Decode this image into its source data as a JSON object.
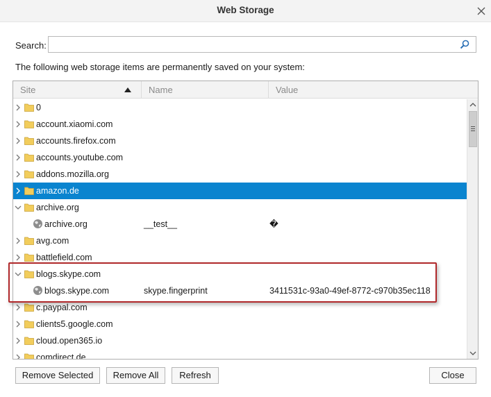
{
  "window": {
    "title": "Web Storage"
  },
  "search": {
    "label": "Search:",
    "value": "",
    "placeholder": ""
  },
  "description": "The following web storage items are permanently saved on your system:",
  "table": {
    "columns": {
      "site": "Site",
      "name": "Name",
      "value": "Value"
    },
    "sort": {
      "column": "Site",
      "direction": "ascending"
    },
    "rows": [
      {
        "type": "folder",
        "site": "0",
        "expanded": false,
        "selected": false
      },
      {
        "type": "folder",
        "site": "account.xiaomi.com",
        "expanded": false,
        "selected": false
      },
      {
        "type": "folder",
        "site": "accounts.firefox.com",
        "expanded": false,
        "selected": false
      },
      {
        "type": "folder",
        "site": "accounts.youtube.com",
        "expanded": false,
        "selected": false
      },
      {
        "type": "folder",
        "site": "addons.mozilla.org",
        "expanded": false,
        "selected": false
      },
      {
        "type": "folder",
        "site": "amazon.de",
        "expanded": false,
        "selected": true
      },
      {
        "type": "folder",
        "site": "archive.org",
        "expanded": true,
        "selected": false
      },
      {
        "type": "item",
        "site": "archive.org",
        "name": "__test__",
        "value": "�"
      },
      {
        "type": "folder",
        "site": "avg.com",
        "expanded": false,
        "selected": false
      },
      {
        "type": "folder",
        "site": "battlefield.com",
        "expanded": false,
        "selected": false
      },
      {
        "type": "folder",
        "site": "blogs.skype.com",
        "expanded": true,
        "selected": false
      },
      {
        "type": "item",
        "site": "blogs.skype.com",
        "name": "skype.fingerprint",
        "value": "3411531c-93a0-49ef-8772-c970b35ec118"
      },
      {
        "type": "folder",
        "site": "c.paypal.com",
        "expanded": false,
        "selected": false
      },
      {
        "type": "folder",
        "site": "clients5.google.com",
        "expanded": false,
        "selected": false
      },
      {
        "type": "folder",
        "site": "cloud.open365.io",
        "expanded": false,
        "selected": false
      },
      {
        "type": "folder",
        "site": "comdirect.de",
        "expanded": false,
        "selected": false
      }
    ]
  },
  "buttons": {
    "remove_selected": "Remove Selected",
    "remove_all": "Remove All",
    "refresh": "Refresh",
    "close": "Close"
  },
  "colors": {
    "selection": "#0a84cf",
    "highlight_border": "#b0282a",
    "folder": "#f2cd5c"
  }
}
